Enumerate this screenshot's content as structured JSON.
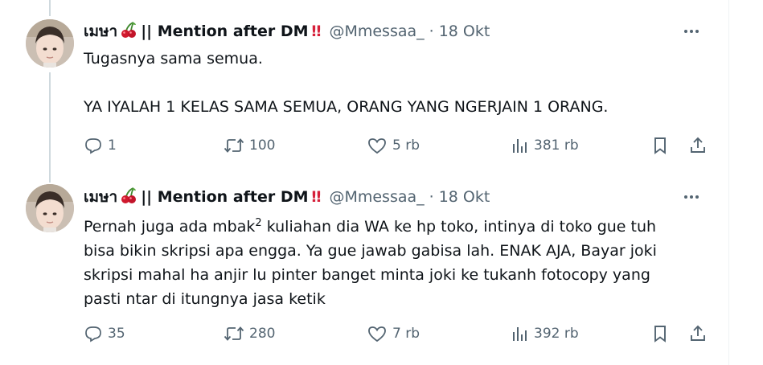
{
  "tweets": [
    {
      "display_name": "เมษา",
      "name_suffix": "|| Mention after DM",
      "emoji_cherry": "🍒",
      "emoji_bang": "‼",
      "handle": "@Mmessaa_",
      "separator": "·",
      "date": "18 Okt",
      "text_lines": [
        "Tugasnya sama semua.",
        "",
        "YA IYALAH 1 KELAS SAMA SEMUA, ORANG YANG NGERJAIN 1 ORANG."
      ],
      "replies": "1",
      "retweets": "100",
      "likes": "5 rb",
      "views": "381 rb"
    },
    {
      "display_name": "เมษา",
      "name_suffix": "|| Mention after DM",
      "emoji_cherry": "🍒",
      "emoji_bang": "‼",
      "handle": "@Mmessaa_",
      "separator": "·",
      "date": "18 Okt",
      "text_line1_a": "Pernah juga ada mbak",
      "text_line1_sup": "2",
      "text_line1_b": " kuliahan dia WA ke hp toko, intinya di toko gue tuh",
      "text_lines_rest": [
        "bisa bikin skripsi apa engga. Ya gue jawab gabisa lah. ENAK AJA, Bayar joki",
        "skripsi mahal ha anjir lu pinter banget minta joki ke tukanh fotocopy yang",
        "pasti ntar di itungnya jasa ketik"
      ],
      "replies": "35",
      "retweets": "280",
      "likes": "7 rb",
      "views": "392 rb"
    }
  ],
  "colors": {
    "text": "#0f1419",
    "muted": "#536471",
    "thread_line": "#cfd9de",
    "bang": "#d6203a"
  },
  "icons": [
    "more-icon",
    "reply-icon",
    "retweet-icon",
    "like-icon",
    "views-icon",
    "bookmark-icon",
    "share-icon"
  ]
}
